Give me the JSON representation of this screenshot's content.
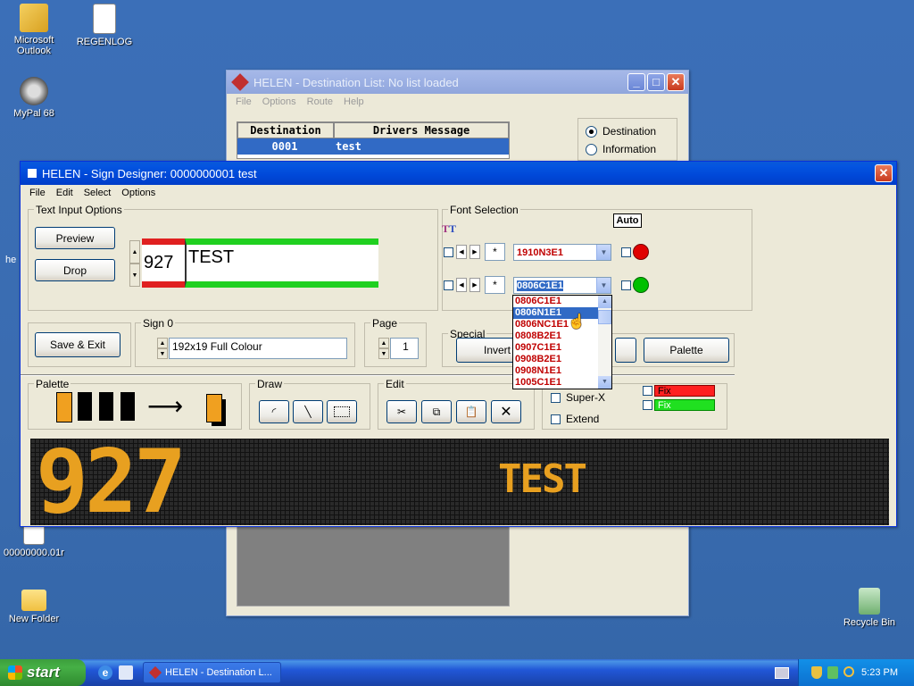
{
  "desktop": {
    "icons": [
      {
        "label": "Microsoft Outlook"
      },
      {
        "label": "REGENLOG"
      },
      {
        "label": "MyPal 68"
      },
      {
        "label": "00000000.01r"
      },
      {
        "label": "New Folder"
      },
      {
        "label": "Recycle Bin"
      }
    ],
    "partial_text": "he"
  },
  "dest_window": {
    "title": "HELEN - Destination List: No list loaded",
    "menu": [
      "File",
      "Options",
      "Route",
      "Help"
    ],
    "table": {
      "headers": [
        "Destination",
        "Drivers Message"
      ],
      "rows": [
        [
          "0001",
          "test"
        ]
      ]
    },
    "radios": [
      {
        "label": "Destination",
        "selected": true
      },
      {
        "label": "Information",
        "selected": false
      }
    ]
  },
  "sign_window": {
    "title": "HELEN - Sign Designer: 0000000001 test",
    "menu": [
      "File",
      "Edit",
      "Select",
      "Options"
    ],
    "text_input": {
      "group_title": "Text Input Options",
      "preview_label": "Preview",
      "drop_label": "Drop",
      "route_number": "927",
      "destination_text": "TEST"
    },
    "font_selection": {
      "group_title": "Font Selection",
      "auto_label": "Auto",
      "row1_star": "*",
      "row1_font": "1910N3E1",
      "row2_star": "*",
      "row2_font": "0806C1E1",
      "status_colors": {
        "row1": "#e00000",
        "row2": "#00c000"
      },
      "dropdown_options": [
        "0806C1E1",
        "0806N1E1",
        "0806NC1E1",
        "0808B2E1",
        "0907C1E1",
        "0908B2E1",
        "0908N1E1",
        "1005C1E1"
      ],
      "dropdown_selected_index": 1
    },
    "save_exit_label": "Save & Exit",
    "sign": {
      "group_title": "Sign 0",
      "value": "192x19 Full Colour"
    },
    "page": {
      "group_title": "Page",
      "value": "1"
    },
    "special": {
      "group_title": "Special",
      "invert_label": "Invert",
      "palette_label": "Palette"
    },
    "palette": {
      "group_title": "Palette",
      "colors": [
        "#f0a020",
        "#000000",
        "#000000",
        "#000000"
      ]
    },
    "draw": {
      "group_title": "Draw"
    },
    "edit": {
      "group_title": "Edit"
    },
    "options": {
      "superx_label": "Super-X",
      "extend_label": "Extend",
      "fix1_label": "Fix",
      "fix1_color": "#ff2020",
      "fix2_label": "Fix",
      "fix2_color": "#20e020"
    },
    "led_display": {
      "route": "927",
      "destination": "TEST",
      "color": "#e8a020"
    }
  },
  "taskbar": {
    "start_label": "start",
    "task_label": "HELEN - Destination L...",
    "clock": "5:23 PM"
  }
}
